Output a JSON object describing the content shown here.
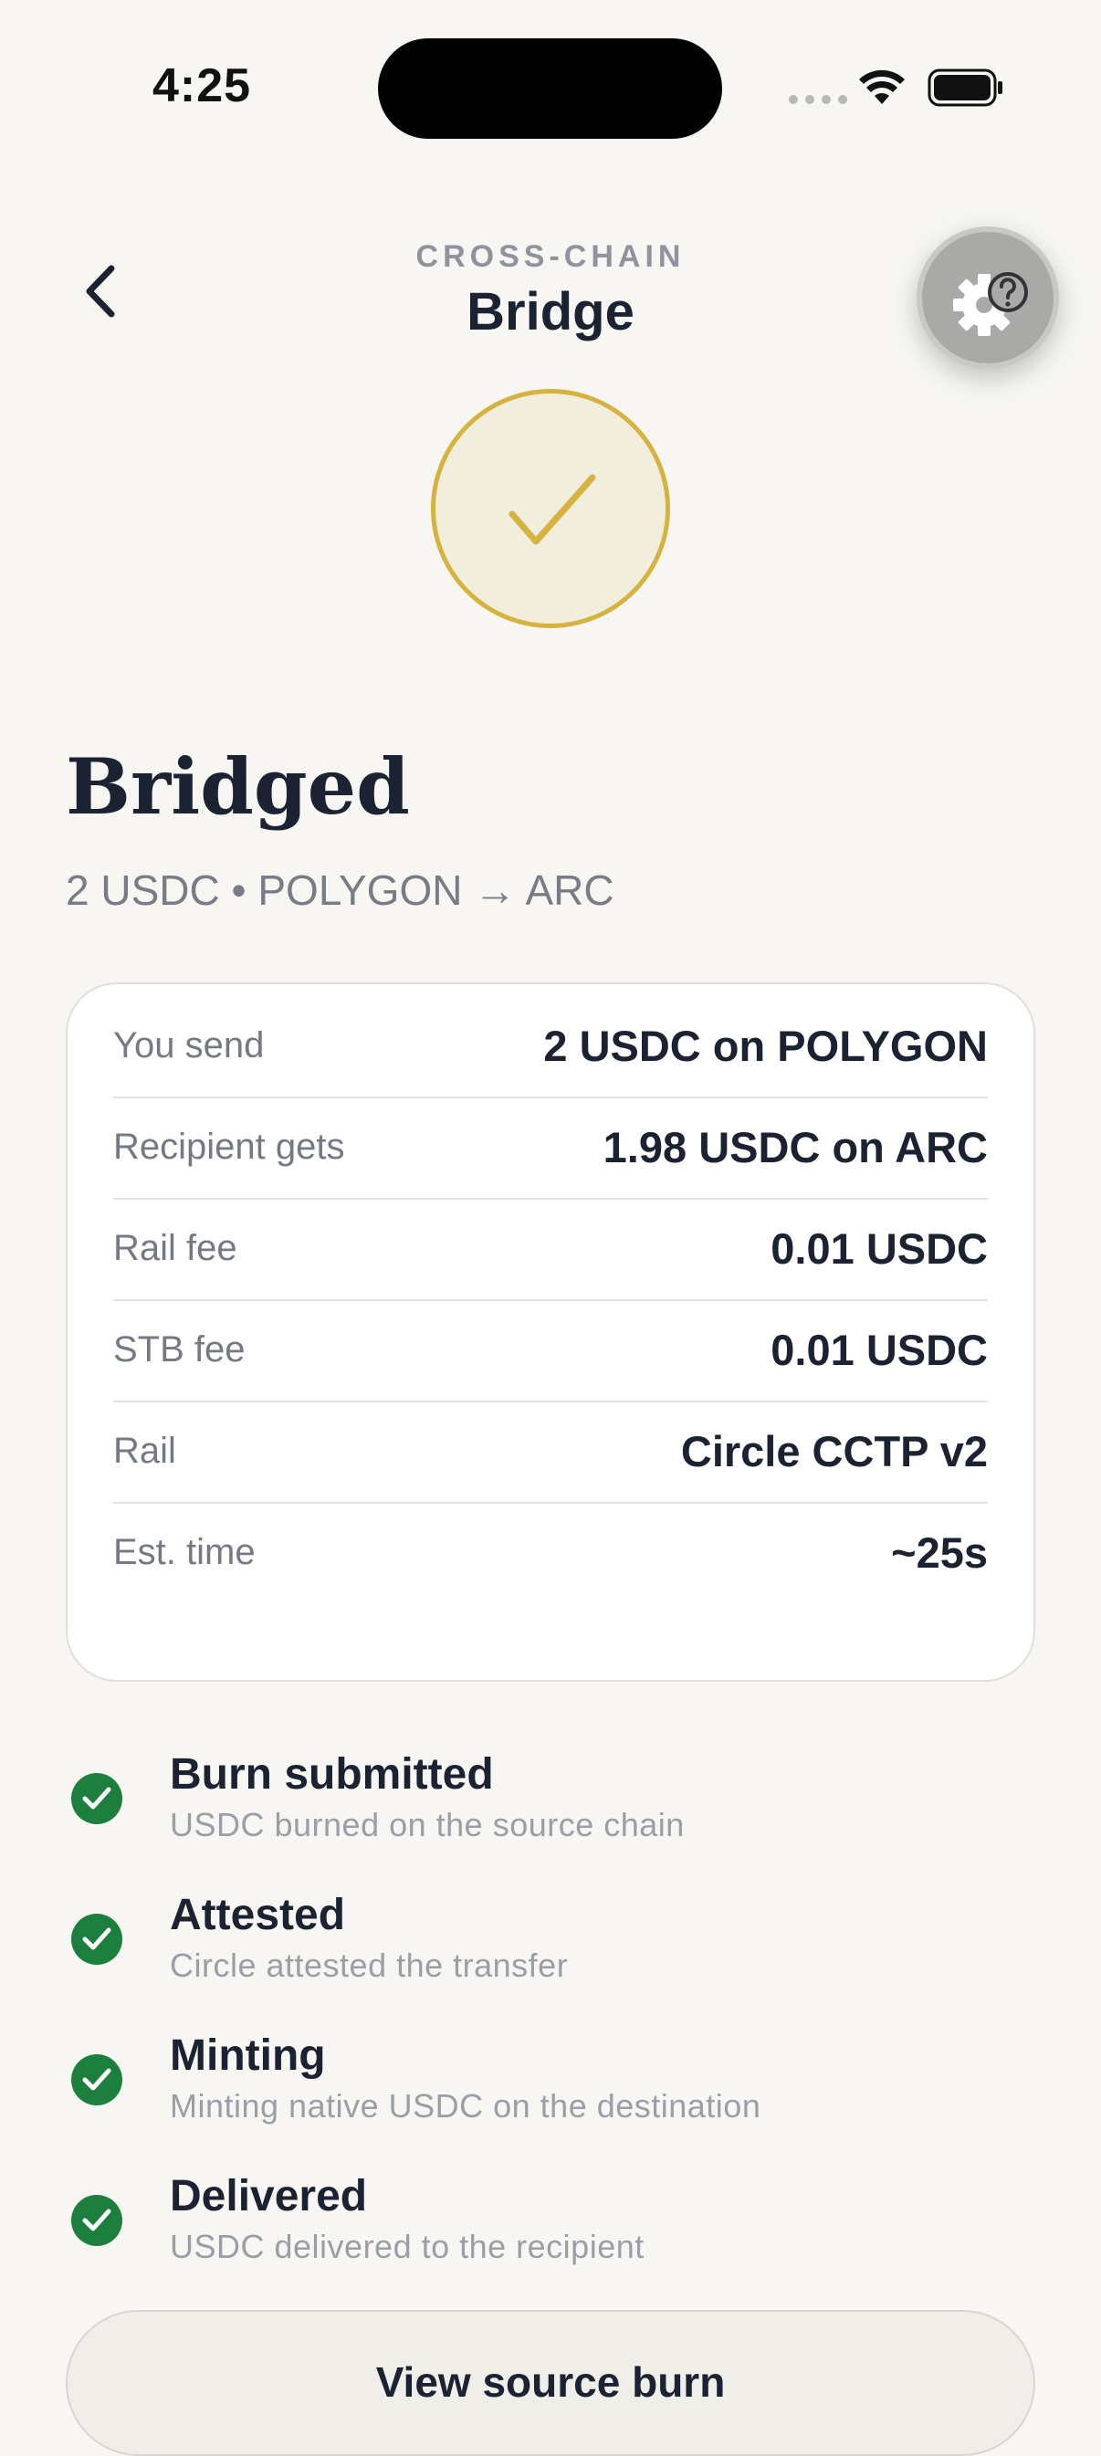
{
  "status_bar": {
    "time": "4:25"
  },
  "header": {
    "eyebrow": "CROSS-CHAIN",
    "title": "Bridge"
  },
  "result": {
    "title": "Bridged",
    "summary": "2 USDC • POLYGON → ARC"
  },
  "details": [
    {
      "label": "You send",
      "value": "2 USDC on POLYGON"
    },
    {
      "label": "Recipient gets",
      "value": "1.98 USDC on ARC"
    },
    {
      "label": "Rail fee",
      "value": "0.01 USDC"
    },
    {
      "label": "STB fee",
      "value": "0.01 USDC"
    },
    {
      "label": "Rail",
      "value": "Circle CCTP v2"
    },
    {
      "label": "Est. time",
      "value": "~25s"
    }
  ],
  "steps": [
    {
      "title": "Burn submitted",
      "desc": "USDC burned on the source chain"
    },
    {
      "title": "Attested",
      "desc": "Circle attested the transfer"
    },
    {
      "title": "Minting",
      "desc": "Minting native USDC on the destination"
    },
    {
      "title": "Delivered",
      "desc": "USDC delivered to the recipient"
    }
  ],
  "actions": {
    "view_source_burn": "View source burn"
  },
  "colors": {
    "accent_gold": "#D6B23E",
    "success_green": "#1C7F3E",
    "background": "#F7F6F2"
  },
  "icons": {
    "back": "chevron-left-icon",
    "help": "gear-question-icon",
    "success": "checkmark-icon"
  }
}
